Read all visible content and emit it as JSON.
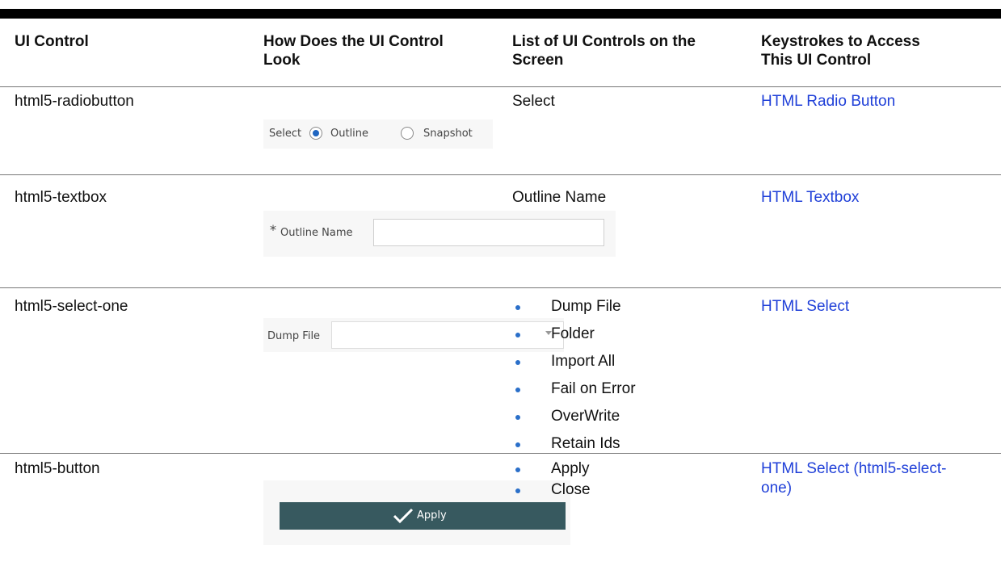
{
  "headers": [
    "UI Control",
    "How Does the UI Control Look",
    "List of UI Controls on the Screen",
    "Keystrokes to Access This UI Control"
  ],
  "header_lines": {
    "col1": [
      "UI Control"
    ],
    "col2": [
      "How Does the UI Control",
      "Look"
    ],
    "col3": [
      "List of UI Controls on the",
      "Screen"
    ],
    "col4": [
      "Keystrokes to Access",
      "This UI Control"
    ]
  },
  "rows": [
    {
      "control": "html5-radiobutton",
      "list": [
        "Select"
      ],
      "link": [
        "HTML Radio Button"
      ],
      "mock": {
        "label": "Select",
        "option1": "Outline",
        "option2": "Snapshot",
        "selected": "Outline"
      }
    },
    {
      "control": "html5-textbox",
      "list": [
        "Outline Name"
      ],
      "link": [
        "HTML Textbox"
      ],
      "mock": {
        "required_mark": "*",
        "label": "Outline Name",
        "value": ""
      }
    },
    {
      "control": "html5-select-one",
      "list": [
        "Dump File",
        "Folder",
        "Import All",
        "Fail on Error",
        "OverWrite",
        "Retain Ids"
      ],
      "link": [
        "HTML Select"
      ],
      "mock": {
        "label": "Dump File",
        "value": ""
      }
    },
    {
      "control": "html5-button",
      "list": [
        "Apply",
        "Close"
      ],
      "link": [
        "HTML Select (html5-select-",
        "one)"
      ],
      "mock": {
        "label": "Apply",
        "icon": "checkmark-icon"
      }
    }
  ],
  "colors": {
    "link": "#1f3fd8",
    "bullet": "#2a6fc9",
    "button_bg": "#37595f",
    "radio_selected": "#1f66c1"
  }
}
